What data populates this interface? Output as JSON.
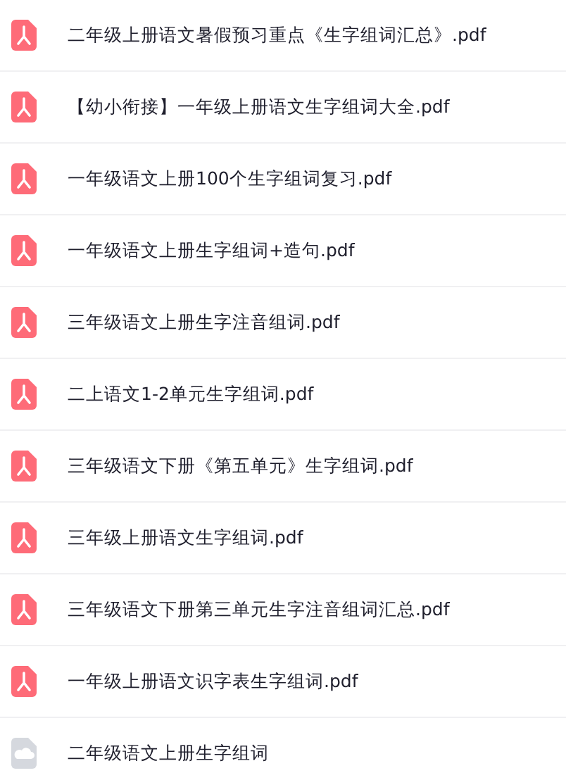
{
  "files": [
    {
      "name": "二年级上册语文暑假预习重点《生字组词汇总》.pdf",
      "kind": "pdf"
    },
    {
      "name": "【幼小衔接】一年级上册语文生字组词大全.pdf",
      "kind": "pdf"
    },
    {
      "name": "一年级语文上册100个生字组词复习.pdf",
      "kind": "pdf"
    },
    {
      "name": "一年级语文上册生字组词+造句.pdf",
      "kind": "pdf"
    },
    {
      "name": "三年级语文上册生字注音组词.pdf",
      "kind": "pdf"
    },
    {
      "name": "二上语文1-2单元生字组词.pdf",
      "kind": "pdf"
    },
    {
      "name": "三年级语文下册《第五单元》生字组词.pdf",
      "kind": "pdf"
    },
    {
      "name": "三年级上册语文生字组词.pdf",
      "kind": "pdf"
    },
    {
      "name": "三年级语文下册第三单元生字注音组词汇总.pdf",
      "kind": "pdf"
    },
    {
      "name": "一年级上册语文识字表生字组词.pdf",
      "kind": "pdf"
    },
    {
      "name": "二年级语文上册生字组词",
      "kind": "cloud"
    }
  ]
}
